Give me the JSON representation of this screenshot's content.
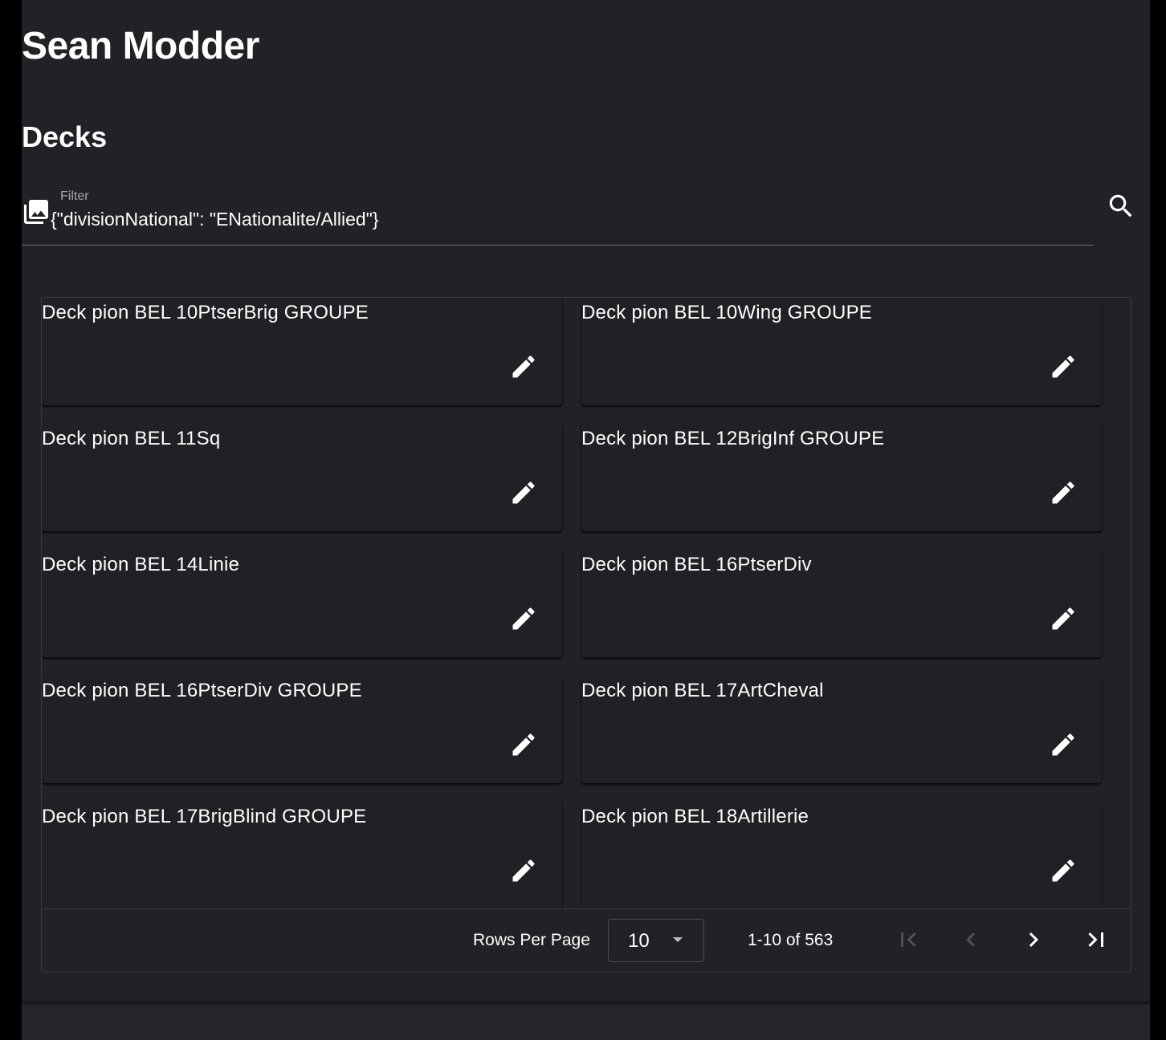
{
  "header": {
    "app_title": "Sean Modder",
    "section_title": "Decks"
  },
  "filter": {
    "label": "Filter",
    "value": "{\"divisionNational\": \"ENationalite/Allied\"}",
    "icon": "collections-icon",
    "search_icon": "search-icon"
  },
  "cards": [
    {
      "title": "Deck pion BEL 10PtserBrig GROUPE",
      "action_icon": "edit-icon"
    },
    {
      "title": "Deck pion BEL 10Wing GROUPE",
      "action_icon": "edit-icon"
    },
    {
      "title": "Deck pion BEL 11Sq",
      "action_icon": "edit-icon"
    },
    {
      "title": "Deck pion BEL 12BrigInf GROUPE",
      "action_icon": "edit-icon"
    },
    {
      "title": "Deck pion BEL 14Linie",
      "action_icon": "edit-icon"
    },
    {
      "title": "Deck pion BEL 16PtserDiv",
      "action_icon": "edit-icon"
    },
    {
      "title": "Deck pion BEL 16PtserDiv GROUPE",
      "action_icon": "edit-icon"
    },
    {
      "title": "Deck pion BEL 17ArtCheval",
      "action_icon": "edit-icon"
    },
    {
      "title": "Deck pion BEL 17BrigBlind GROUPE",
      "action_icon": "edit-icon"
    },
    {
      "title": "Deck pion BEL 18Artillerie",
      "action_icon": "edit-icon"
    }
  ],
  "pagination": {
    "rows_per_page_label": "Rows Per Page",
    "rows_per_page_value": "10",
    "range": "1-10 of 563",
    "first_enabled": false,
    "prev_enabled": false,
    "next_enabled": true,
    "last_enabled": true
  },
  "colors": {
    "background": "#212126",
    "text": "#ffffff",
    "disabled_icon": "#5a5a5f"
  }
}
